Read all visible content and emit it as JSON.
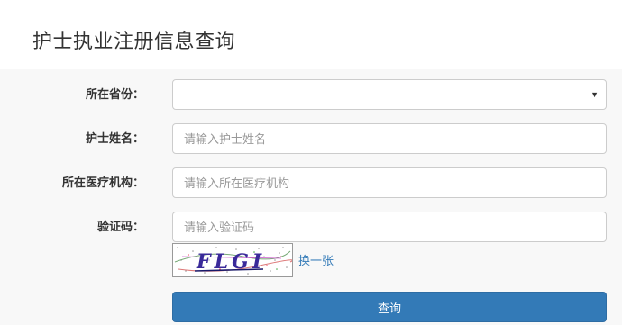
{
  "page": {
    "title": "护士执业注册信息查询"
  },
  "form": {
    "province": {
      "label": "所在省份：",
      "value": ""
    },
    "name": {
      "label": "护士姓名：",
      "placeholder": "请输入护士姓名"
    },
    "institution": {
      "label": "所在医疗机构：",
      "placeholder": "请输入所在医疗机构"
    },
    "captcha": {
      "label": "验证码：",
      "placeholder": "请输入验证码",
      "image_text": "FLGI",
      "refresh_label": "换一张"
    },
    "submit_label": "查询"
  }
}
